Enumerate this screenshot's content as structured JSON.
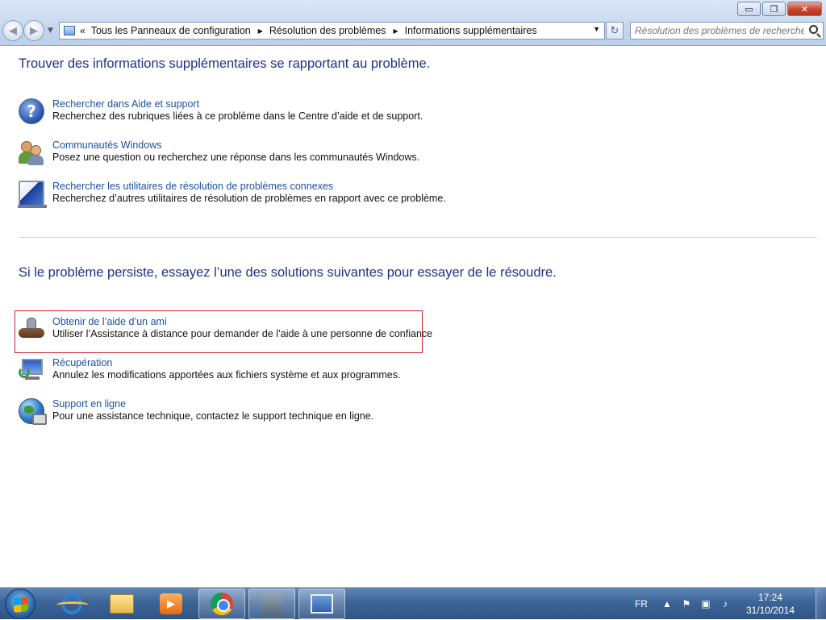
{
  "window": {
    "buttons": {
      "minimize": "▭",
      "maximize": "❐",
      "close": "✕"
    }
  },
  "address_bar": {
    "chevron": "«",
    "breadcrumbs": [
      "Tous les Panneaux de configuration",
      "Résolution des problèmes",
      "Informations supplémentaires"
    ],
    "separator": "▶",
    "dropdown": "▼",
    "refresh": "↻"
  },
  "search": {
    "placeholder": "Résolution des problèmes de recherche"
  },
  "content": {
    "heading1": "Trouver des informations supplémentaires se rapportant au problème.",
    "section1": [
      {
        "icon": "help-icon",
        "link": "Rechercher dans Aide et support",
        "desc": "Recherchez des rubriques liées à ce problème dans le Centre d’aide et de support."
      },
      {
        "icon": "people-icon",
        "link": "Communautés Windows",
        "desc": "Posez une question ou recherchez une réponse dans les communautés Windows."
      },
      {
        "icon": "troubleshoot-icon",
        "link": "Rechercher les utilitaires de résolution de problèmes connexes",
        "desc": "Recherchez d’autres utilitaires de résolution de problèmes en rapport avec ce problème."
      }
    ],
    "heading2": "Si le problème persiste, essayez l’une des solutions suivantes pour essayer de le résoudre.",
    "section2": [
      {
        "icon": "remote-assistance-icon",
        "link": "Obtenir de l’aide d’un ami",
        "desc": "Utiliser l’Assistance à distance pour demander de l’aide à une personne de confiance"
      },
      {
        "icon": "system-restore-icon",
        "link": "Récupération",
        "desc": "Annulez les modifications apportées aux fichiers système et aux programmes."
      },
      {
        "icon": "globe-icon",
        "link": "Support en ligne",
        "desc": "Pour une assistance technique, contactez le support technique en ligne."
      }
    ]
  },
  "taskbar": {
    "apps": [
      "internet-explorer-icon",
      "file-explorer-icon",
      "media-player-icon",
      "chrome-icon",
      "remote-assistance-icon",
      "control-panel-icon"
    ],
    "language": "FR",
    "tray_expand": "▲",
    "time": "17:24",
    "date": "31/10/2014"
  }
}
